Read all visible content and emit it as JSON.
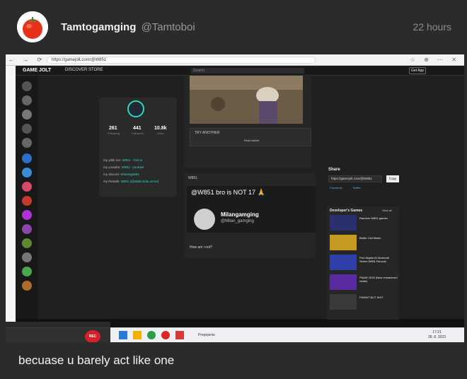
{
  "post": {
    "author_name": "Tamtogamging",
    "author_handle": "@Tamtoboi",
    "time_ago": "22 hours",
    "text": "becuase u barely act like one"
  },
  "screenshot": {
    "browser_url": "https://gamejolt.com/@W851",
    "site": {
      "logo": "GAME JOLT",
      "nav": "DISCOVER   STORE",
      "search_placeholder": "Search",
      "get_app": "Get App"
    },
    "profile": {
      "stats": [
        {
          "num": "261",
          "label": "Following"
        },
        {
          "num": "441",
          "label": "Followers"
        },
        {
          "num": "10.8k",
          "label": "Likes"
        }
      ],
      "links": [
        {
          "key": "my yt/tik ton:",
          "val": "W851 - Tick.to"
        },
        {
          "key": "my youtube:",
          "val": "W851 - youtube"
        },
        {
          "key": "my discord:",
          "val": "Walvwigs851"
        },
        {
          "key": "my threads:",
          "val": "W851 (@w851.bolu.ocrnd)"
        }
      ]
    },
    "feed": {
      "try_another": "TRY ANOTHER",
      "read_article": "Read article",
      "post_author": "W851",
      "meme_top_text": "@W851 bro is NOT 17 🙏",
      "meme_name": "Milangamging",
      "meme_handle": "@Milan_gamging",
      "caption": "How am i not?"
    },
    "share": {
      "title": "Share",
      "url": "https://gamejolt.com/@W851",
      "copy": "Copy",
      "facebook": "Facebook",
      "twitter": "Twitter"
    },
    "dev_games": {
      "title": "Developer's Games",
      "view_all": "View all",
      "items": [
        "Random W851 games",
        "Better Call Warto",
        "Five Nights At Illuminati Series W851 Recode",
        "FNAW 2018 (New remastered relate)",
        "FNWNT BUT SHIT"
      ]
    },
    "taskbar": {
      "label": "Prepojenie",
      "clock_time": "17:21",
      "clock_date": "28. 8. 2023"
    },
    "recorder": {
      "rec_label": "REC"
    }
  }
}
